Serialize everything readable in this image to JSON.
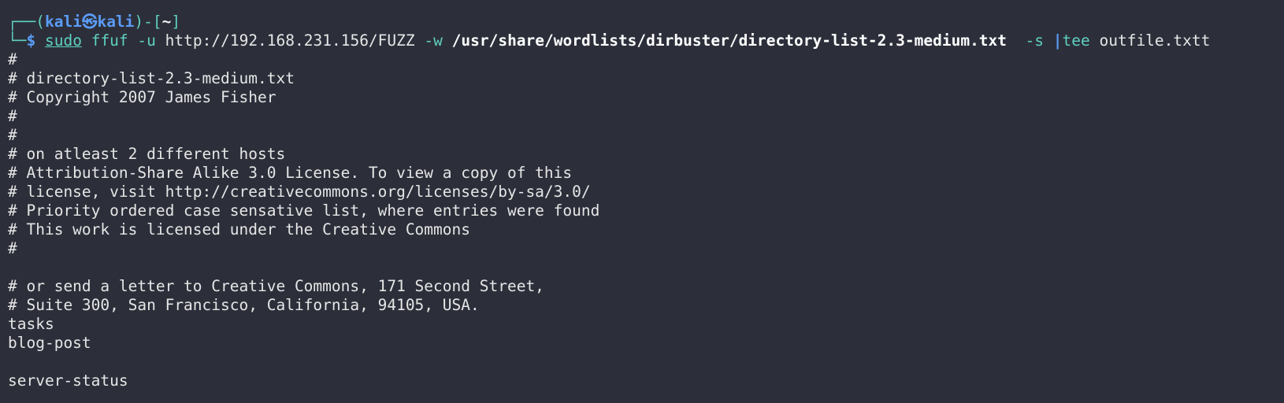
{
  "prompt": {
    "open_frame": "┌──(",
    "user": "kali",
    "at_symbol": "㉿",
    "host": "kali",
    "close_mid": ")-[",
    "dir": "~",
    "close_frame": "]",
    "second_frame": "└─",
    "dollar": "$"
  },
  "command": {
    "sudo": "sudo",
    "program": "ffuf",
    "flag_u": "-u",
    "url": "http://192.168.231.156/FUZZ",
    "flag_w": "-w",
    "wordlist": "/usr/share/wordlists/dirbuster/directory-list-2.3-medium.txt",
    "flag_s": "-s",
    "pipe": "|",
    "tee": "tee",
    "outfile": "outfile.txtt"
  },
  "output_lines": [
    "#",
    "# directory-list-2.3-medium.txt",
    "# Copyright 2007 James Fisher",
    "#",
    "#",
    "# on atleast 2 different hosts",
    "# Attribution-Share Alike 3.0 License. To view a copy of this",
    "# license, visit http://creativecommons.org/licenses/by-sa/3.0/",
    "# Priority ordered case sensative list, where entries were found",
    "# This work is licensed under the Creative Commons",
    "#",
    "",
    "# or send a letter to Creative Commons, 171 Second Street,",
    "# Suite 300, San Francisco, California, 94105, USA.",
    "tasks",
    "blog-post",
    "",
    "server-status"
  ],
  "colors": {
    "background": "#2c2f3a",
    "frame": "#5fd0c0",
    "user": "#5b9cf7",
    "text": "#e6e6e6"
  }
}
